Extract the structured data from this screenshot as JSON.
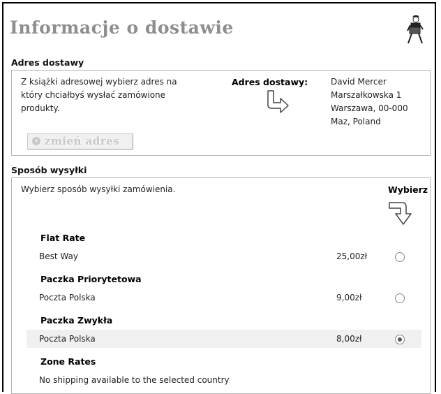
{
  "page": {
    "title": "Informacje o dostawie"
  },
  "address_section": {
    "heading": "Adres dostawy",
    "instructions_lines": [
      "Z książki adresowej wybierz adres na",
      "który chciałbyś wysłać zamówione",
      "produkty."
    ],
    "label": "Adres dostawy:",
    "address_lines": [
      "David Mercer",
      "Marszałkowska 1",
      "Warszawa, 00-000",
      "Maz, Poland"
    ],
    "change_button_label": "zmień adres"
  },
  "shipping_section": {
    "heading": "Sposób wysyłki",
    "instructions": "Wybierz sposób wysyłki zamówienia.",
    "choose_label": "Wybierz",
    "methods": [
      {
        "name": "Flat Rate",
        "option": "Best Way",
        "price": "25,00zł",
        "selected": false
      },
      {
        "name": "Paczka Priorytetowa",
        "option": "Poczta Polska",
        "price": "9,00zł",
        "selected": false
      },
      {
        "name": "Paczka Zwykła",
        "option": "Poczta Polska",
        "price": "8,00zł",
        "selected": true
      }
    ],
    "zone_rates": {
      "name": "Zone Rates",
      "message": "No shipping available to the selected country"
    }
  }
}
